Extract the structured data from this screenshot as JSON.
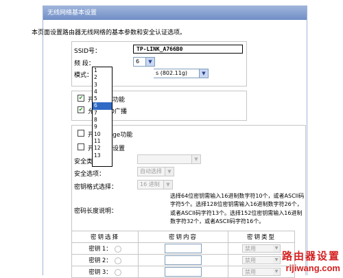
{
  "title": "无线网络基本设置",
  "intro": "本页面设置路由器无线网络的基本参数和安全认证选项。",
  "ssid_label": "SSID号：",
  "ssid_value": "TP-LINK_A766B0",
  "channel_label": "频  段：",
  "channel_value": "6",
  "mode_label": "模式：",
  "mode_value": "s (802.11g)",
  "channel_options": [
    "1",
    "2",
    "3",
    "4",
    "5",
    "6",
    "7",
    "8",
    "9",
    "10",
    "11",
    "12",
    "13"
  ],
  "channel_selected": "6",
  "wireless_enable": {
    "label": "开启无线功能",
    "checked": true
  },
  "ssid_broadcast": {
    "label": "允许SSID广播",
    "checked": true
  },
  "bridge": {
    "label": "开启Bridge功能",
    "checked": false
  },
  "security_enable": {
    "label": "开启安全设置",
    "checked": false
  },
  "security_type_label": "安全类型：",
  "security_option_label": "安全选项：",
  "security_option_value": "自动选择",
  "key_format_label": "密钥格式选择：",
  "key_format_value": "16 进制",
  "key_length_label": "密码长度说明：",
  "key_length_desc": "选择64位密钥需输入16进制数字符10个，或者ASCII码字符5个。选择128位密钥需输入16进制数字符26个，或者ASCII码字符13个。选择152位密钥需输入16进制数字符32个，或者ASCII码字符16个。",
  "key_table": {
    "headers": [
      "密钥选择",
      "密钥内容",
      "密钥类型"
    ],
    "rows": [
      {
        "label": "密钥 1：",
        "type": "禁用"
      },
      {
        "label": "密钥 2：",
        "type": "禁用"
      },
      {
        "label": "密钥 3：",
        "type": "禁用"
      }
    ]
  },
  "watermark": {
    "cn": "路由器设置",
    "en": "rijiwang.com"
  }
}
